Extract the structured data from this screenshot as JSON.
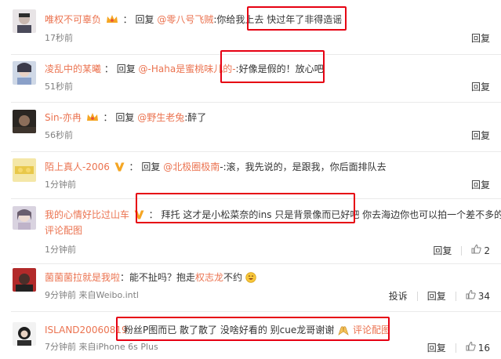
{
  "comments": [
    {
      "user": "唯权不可辜负",
      "badge": "crown-icon",
      "reply_word": "回复",
      "reply_to": "@零八号飞贼",
      "text_a": ":你给我上去",
      "text_b": "快过年了非得造谣",
      "time": "17秒前",
      "actions": [
        "回复"
      ]
    },
    {
      "user": "凌乱中的某曦",
      "reply_word": "回复",
      "reply_to": "@-Haha是蜜桃味儿的-",
      "text_a": ":",
      "text_b": "好像是假的！放心吧",
      "time": "51秒前",
      "actions": [
        "回复"
      ]
    },
    {
      "user": "Sin-亦冉",
      "badge": "crown-icon",
      "reply_word": "回复",
      "reply_to": "@野生老兔",
      "text_a": ":醉了",
      "time": "56秒前",
      "actions": [
        "回复"
      ]
    },
    {
      "user": "陌上真人-2006",
      "badge": "v-icon",
      "reply_word": "回复",
      "reply_to": "@北极圈极南",
      "text_a": "-:滚，我先说的，是跟我，你后面排队去",
      "time": "1分钟前",
      "actions": [
        "回复"
      ]
    },
    {
      "user": "我的心情好比过山车",
      "badge": "v-icon",
      "text_b": "拜托 这才是小松菜奈的ins 只是背景像而已好吧",
      "text_c": " 你去海边你也可以拍一个差不多的",
      "line2_link": "评论配图",
      "time": "1分钟前",
      "actions": [
        "回复"
      ],
      "likes": "2"
    },
    {
      "user": "菌菌菌拉就是我啦",
      "text_a": "：能不扯吗？抱走",
      "tag_link": "权志龙",
      "text_d": "不约",
      "emoji": "smile-emoji",
      "time": "9分钟前 来自Weibo.intl",
      "actions": [
        "投诉",
        "回复"
      ],
      "likes": "34"
    },
    {
      "user": "ISLAND20060819",
      "text_b": "粉丝P图而已 散了散了 没啥好看的 别cue龙哥谢谢",
      "emoji": "praying-hands-emoji",
      "inline_link": "评论配图",
      "time": "7分钟前 来自iPhone 6s Plus",
      "actions": [
        "回复"
      ],
      "likes": "16"
    }
  ],
  "colors": {
    "username": "#eb7350",
    "highlight": "#e60012",
    "meta": "#808080"
  }
}
